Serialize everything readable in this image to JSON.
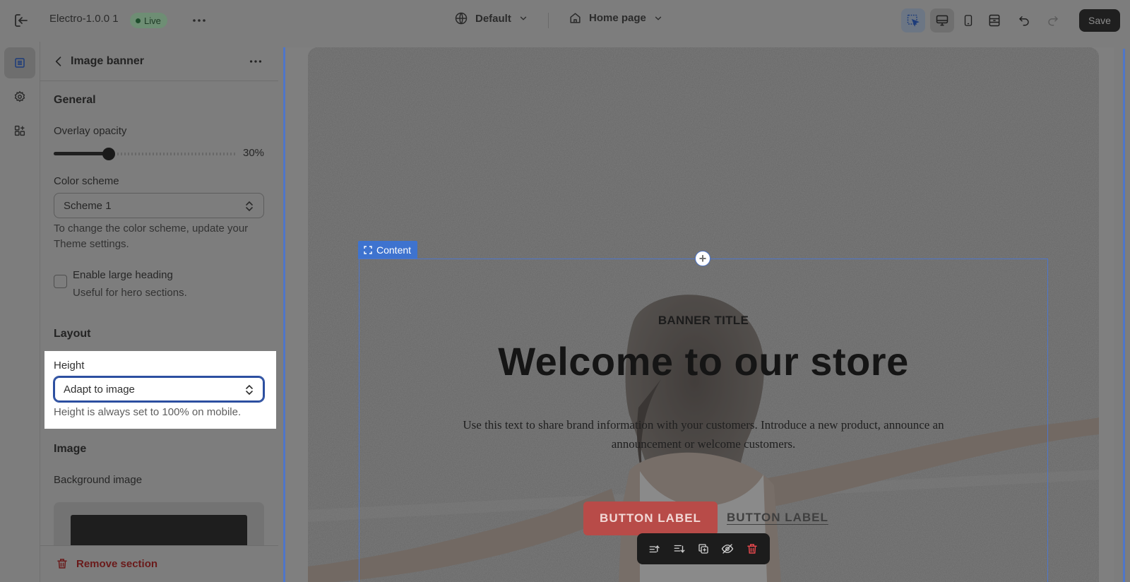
{
  "topbar": {
    "theme_name": "Electro-1.0.0 1",
    "live_badge": "Live",
    "context": "Default",
    "page": "Home page",
    "save_label": "Save"
  },
  "sidebar": {
    "title": "Image banner",
    "general_heading": "General",
    "overlay_label": "Overlay opacity",
    "overlay_value": "30%",
    "overlay_fraction": 0.3,
    "color_scheme_label": "Color scheme",
    "color_scheme_value": "Scheme 1",
    "color_scheme_help_1": "To change the color scheme, update your",
    "color_scheme_help_2": "Theme settings.",
    "large_heading_label": "Enable large heading",
    "large_heading_help": "Useful for hero sections.",
    "large_heading_checked": false,
    "layout_heading": "Layout",
    "height_label": "Height",
    "height_value": "Adapt to image",
    "height_help": "Height is always set to 100% on mobile.",
    "image_heading": "Image",
    "background_image_label": "Background image",
    "remove_section": "Remove section"
  },
  "preview": {
    "content_tag": "Content",
    "banner_subtitle": "BANNER TITLE",
    "banner_title": "Welcome to our store",
    "banner_text": "Use this text to share brand information with your customers. Introduce a new product, announce an announcement or welcome customers.",
    "button_primary": "BUTTON LABEL",
    "button_secondary": "BUTTON LABEL"
  },
  "colors": {
    "accent_blue": "#4f76c9",
    "primary_button": "#b84b48",
    "danger": "#6a1a1a"
  }
}
